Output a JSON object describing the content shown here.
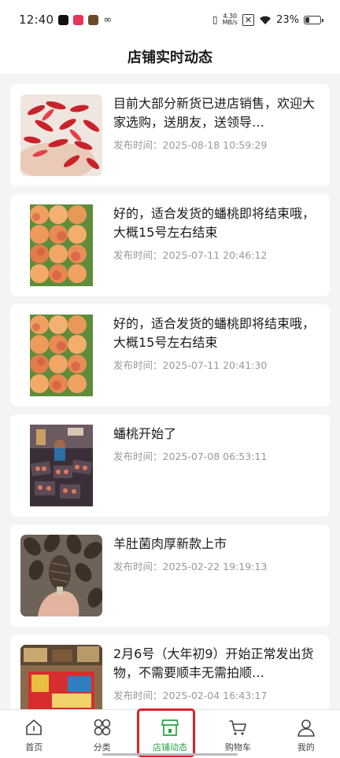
{
  "status_bar": {
    "time": "12:40",
    "net_speed_value": "4.30",
    "net_speed_unit": "MB/s",
    "battery": "23%"
  },
  "header": {
    "title": "店铺实时动态"
  },
  "posts": [
    {
      "title": "目前大部分新货已进店销售，欢迎大家选购，送朋友，送领导…",
      "time_label": "发布时间：",
      "time": "2025-08-18 10:59:29",
      "image": "goji-berries"
    },
    {
      "title": "好的，适合发货的蟠桃即将结束哦，大概15号左右结束",
      "time_label": "发布时间：",
      "time": "2025-07-11 20:46:12",
      "image": "peaches"
    },
    {
      "title": "好的，适合发货的蟠桃即将结束哦，大概15号左右结束",
      "time_label": "发布时间：",
      "time": "2025-07-11 20:41:30",
      "image": "peaches"
    },
    {
      "title": "蟠桃开始了",
      "time_label": "发布时间：",
      "time": "2025-07-08 06:53:11",
      "image": "peach-market"
    },
    {
      "title": "羊肚菌肉厚新款上市",
      "time_label": "发布时间：",
      "time": "2025-02-22 19:19:13",
      "image": "morel-mushrooms"
    },
    {
      "title": "2月6号（大年初9）开始正常发出货物，不需要顺丰无需拍顺…",
      "time_label": "发布时间：",
      "time": "2025-02-04 16:43:17",
      "image": "shop-boxes"
    }
  ],
  "tabbar": {
    "items": [
      {
        "label": "首页",
        "icon": "home-icon"
      },
      {
        "label": "分类",
        "icon": "category-icon"
      },
      {
        "label": "店铺动态",
        "icon": "store-icon",
        "active": true
      },
      {
        "label": "购物车",
        "icon": "cart-icon"
      },
      {
        "label": "我的",
        "icon": "profile-icon"
      }
    ],
    "active_color": "#25a244"
  },
  "annotation_color": "#e0202a"
}
